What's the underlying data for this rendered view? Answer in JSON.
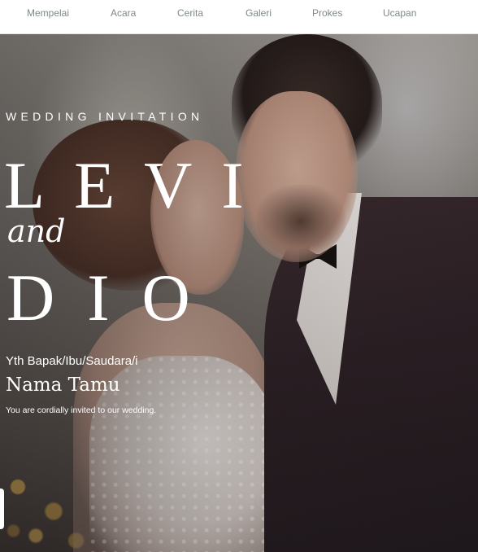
{
  "nav": {
    "items": [
      "Mempelai",
      "Acara",
      "Cerita",
      "Galeri",
      "Prokes",
      "Ucapan"
    ]
  },
  "hero": {
    "eyebrow": "WEDDING INVITATION",
    "name_first": "LEVI",
    "connector": "and",
    "name_second": "DIO",
    "greeting": "Yth Bapak/Ibu/Saudara/i",
    "guest_name": "Nama Tamu",
    "invite_text": "You are cordially invited to our wedding."
  },
  "colors": {
    "nav_text": "#7d8a86",
    "nav_bg": "#ffffff",
    "hero_text": "#ffffff"
  }
}
